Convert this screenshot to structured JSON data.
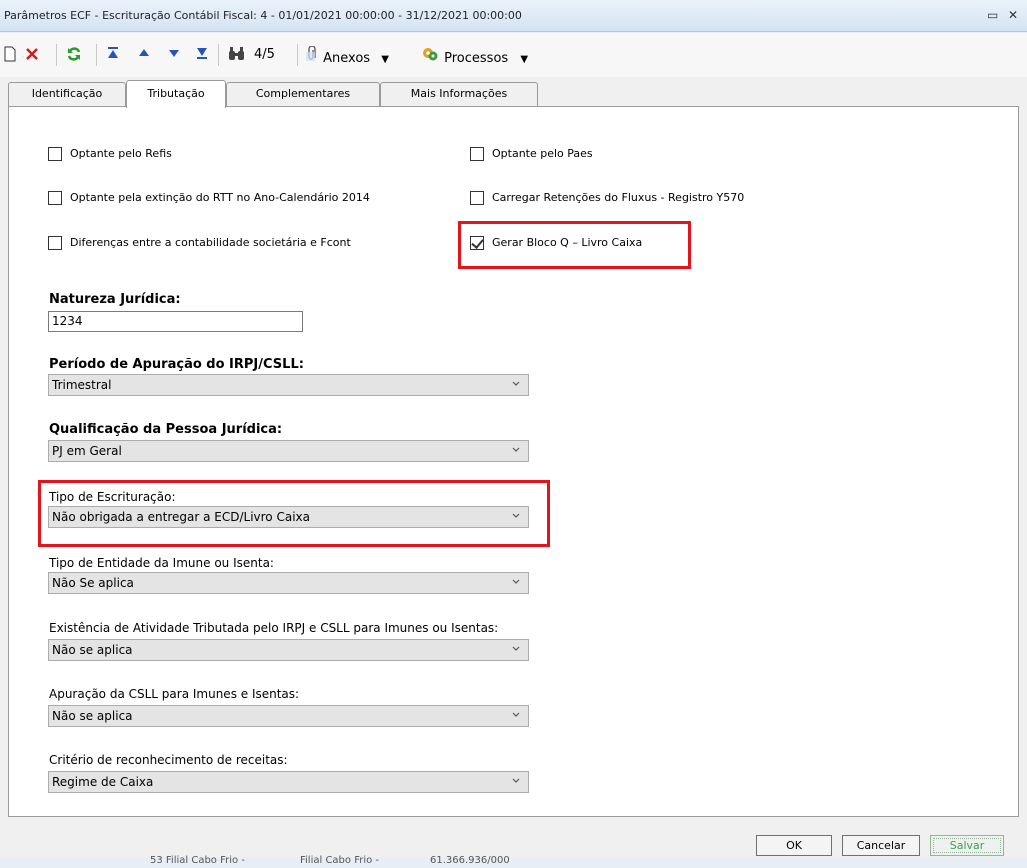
{
  "window": {
    "title": "Parâmetros ECF - Escrituração Contábil Fiscal: 4 - 01/01/2021 00:00:00 - 31/12/2021 00:00:00",
    "restore_glyph": "▭",
    "close_glyph": "✕"
  },
  "toolbar": {
    "record_position": "4/5",
    "anexos_label": "Anexos",
    "processos_label": "Processos"
  },
  "tabs": [
    "Identificação",
    "Tributação",
    "Complementares",
    "Mais Informações"
  ],
  "checkboxes": {
    "refis": {
      "label": "Optante pelo Refis",
      "checked": false
    },
    "paes": {
      "label": "Optante pelo Paes",
      "checked": false
    },
    "rtt": {
      "label": "Optante pela extinção do RTT no Ano-Calendário 2014",
      "checked": false
    },
    "retencoes": {
      "label": "Carregar Retenções do Fluxus - Registro Y570",
      "checked": false
    },
    "fcont": {
      "label": "Diferenças entre a contabilidade societária e Fcont",
      "checked": false
    },
    "bloco_q": {
      "label": "Gerar Bloco Q – Livro Caixa",
      "checked": true
    }
  },
  "fields": {
    "natureza": {
      "label": "Natureza Jurídica:",
      "value": "1234"
    },
    "periodo": {
      "label": "Período de Apuração do IRPJ/CSLL:",
      "value": "Trimestral"
    },
    "qualificacao": {
      "label": "Qualificação da Pessoa Jurídica:",
      "value": "PJ em Geral"
    },
    "tipo_escrituracao": {
      "label": "Tipo de Escrituração:",
      "value": "Não obrigada a entregar a ECD/Livro Caixa"
    },
    "tipo_entidade": {
      "label": "Tipo de Entidade da Imune ou Isenta:",
      "value": "Não Se aplica"
    },
    "atividade": {
      "label": "Existência de Atividade Tributada pelo IRPJ e CSLL para Imunes ou Isentas:",
      "value": "Não se aplica"
    },
    "apuracao_csll": {
      "label": "Apuração da CSLL para Imunes e Isentas:",
      "value": "Não se aplica"
    },
    "criterio": {
      "label": "Critério de reconhecimento de receitas:",
      "value": "Regime de Caixa"
    }
  },
  "buttons": {
    "ok": "OK",
    "cancel": "Cancelar",
    "save": "Salvar"
  },
  "background_row": {
    "c1": "53 Filial Cabo Frio -",
    "c2": "Filial Cabo Frio -",
    "c3": "61.366.936/000"
  },
  "colors": {
    "highlight": "#e3141b",
    "save_disabled": "#3aa05a"
  }
}
